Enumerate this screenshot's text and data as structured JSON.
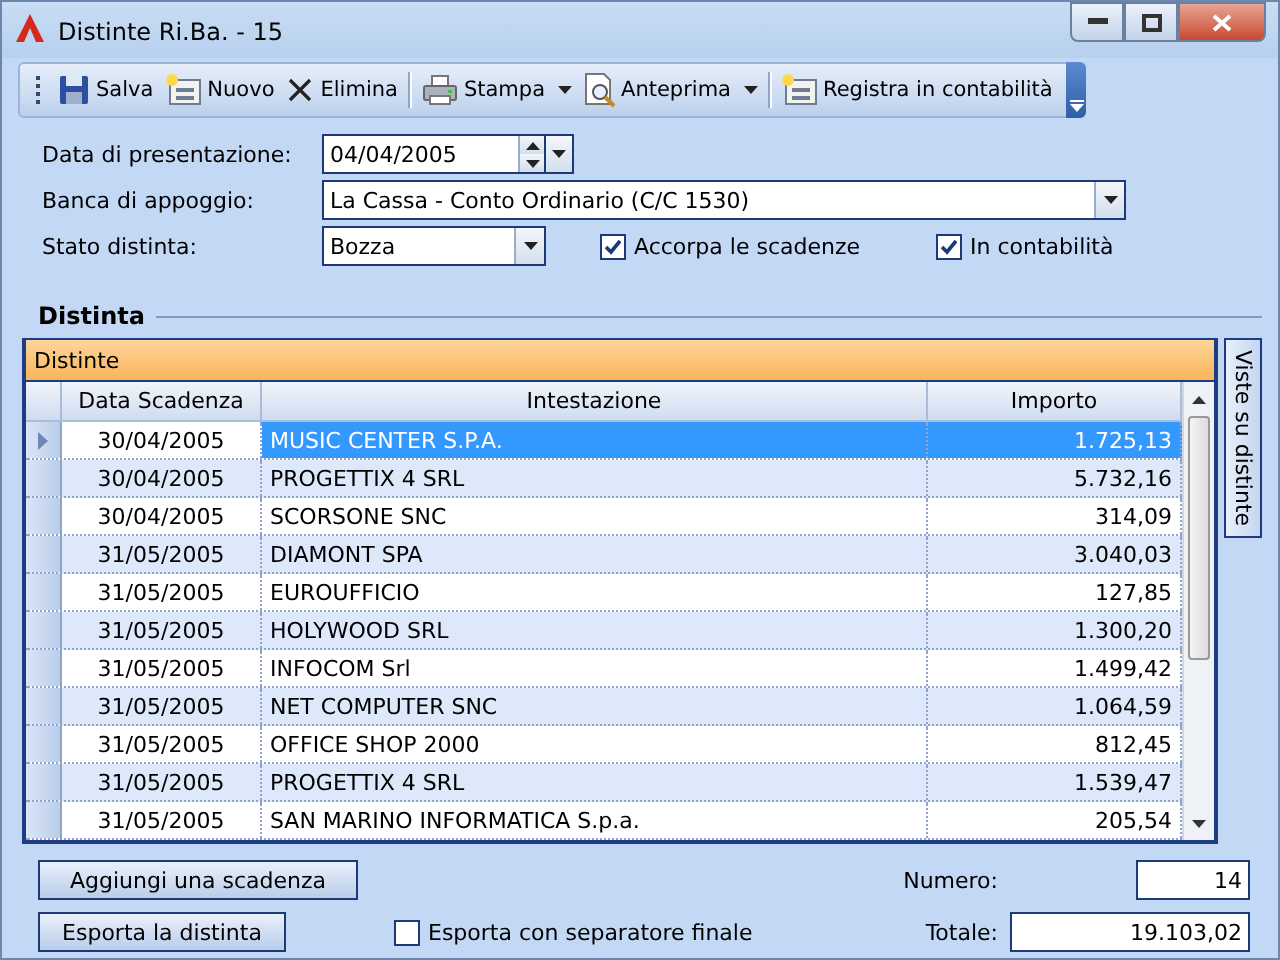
{
  "window": {
    "title": "Distinte Ri.Ba. - 15"
  },
  "toolbar": [
    {
      "kind": "button",
      "label": "Salva",
      "separator_before": false
    },
    {
      "kind": "button",
      "label": "Nuovo",
      "separator_before": false
    },
    {
      "kind": "button",
      "label": "Elimina",
      "separator_before": false
    },
    {
      "kind": "dropdown",
      "label": "Stampa",
      "separator_before": true
    },
    {
      "kind": "dropdown",
      "label": "Anteprima",
      "separator_before": false
    },
    {
      "kind": "button",
      "label": "Registra in contabilità",
      "separator_before": true
    }
  ],
  "form": {
    "date": {
      "label": "Data di presentazione:",
      "value": "04/04/2005"
    },
    "bank": {
      "label": "Banca di appoggio:",
      "value": "La Cassa - Conto Ordinario (C/C 1530)"
    },
    "status": {
      "label": "Stato distinta:",
      "value": "Bozza"
    },
    "checkboxes": [
      {
        "label": "Accorpa le scadenze",
        "checked": true
      },
      {
        "label": "In contabilità",
        "checked": true
      }
    ]
  },
  "section_title": "Distinta",
  "grid": {
    "caption": "Distinte",
    "side_tab": "Viste su distinte",
    "columns": [
      "Data Scadenza",
      "Intestazione",
      "Importo"
    ],
    "rows": [
      {
        "date": "30/04/2005",
        "name": "MUSIC CENTER S.P.A.",
        "amount": "1.725,13",
        "selected": true
      },
      {
        "date": "30/04/2005",
        "name": "PROGETTIX 4 SRL",
        "amount": "5.732,16",
        "selected": false
      },
      {
        "date": "30/04/2005",
        "name": "SCORSONE SNC",
        "amount": "314,09",
        "selected": false
      },
      {
        "date": "31/05/2005",
        "name": "DIAMONT SPA",
        "amount": "3.040,03",
        "selected": false
      },
      {
        "date": "31/05/2005",
        "name": "EUROUFFICIO",
        "amount": "127,85",
        "selected": false
      },
      {
        "date": "31/05/2005",
        "name": "HOLYWOOD SRL",
        "amount": "1.300,20",
        "selected": false
      },
      {
        "date": "31/05/2005",
        "name": "INFOCOM Srl",
        "amount": "1.499,42",
        "selected": false
      },
      {
        "date": "31/05/2005",
        "name": "NET COMPUTER SNC",
        "amount": "1.064,59",
        "selected": false
      },
      {
        "date": "31/05/2005",
        "name": "OFFICE SHOP 2000",
        "amount": "812,45",
        "selected": false
      },
      {
        "date": "31/05/2005",
        "name": "PROGETTIX 4 SRL",
        "amount": "1.539,47",
        "selected": false
      },
      {
        "date": "31/05/2005",
        "name": "SAN MARINO INFORMATICA S.p.a.",
        "amount": "205,54",
        "selected": false
      }
    ]
  },
  "bottom": {
    "buttons": [
      "Aggiungi una scadenza",
      "Esporta la distinta"
    ],
    "export_option": {
      "label": "Esporta con separatore finale",
      "checked": false
    },
    "count": {
      "label": "Numero:",
      "value": "14"
    },
    "total": {
      "label": "Totale:",
      "value": "19.103,02"
    }
  }
}
